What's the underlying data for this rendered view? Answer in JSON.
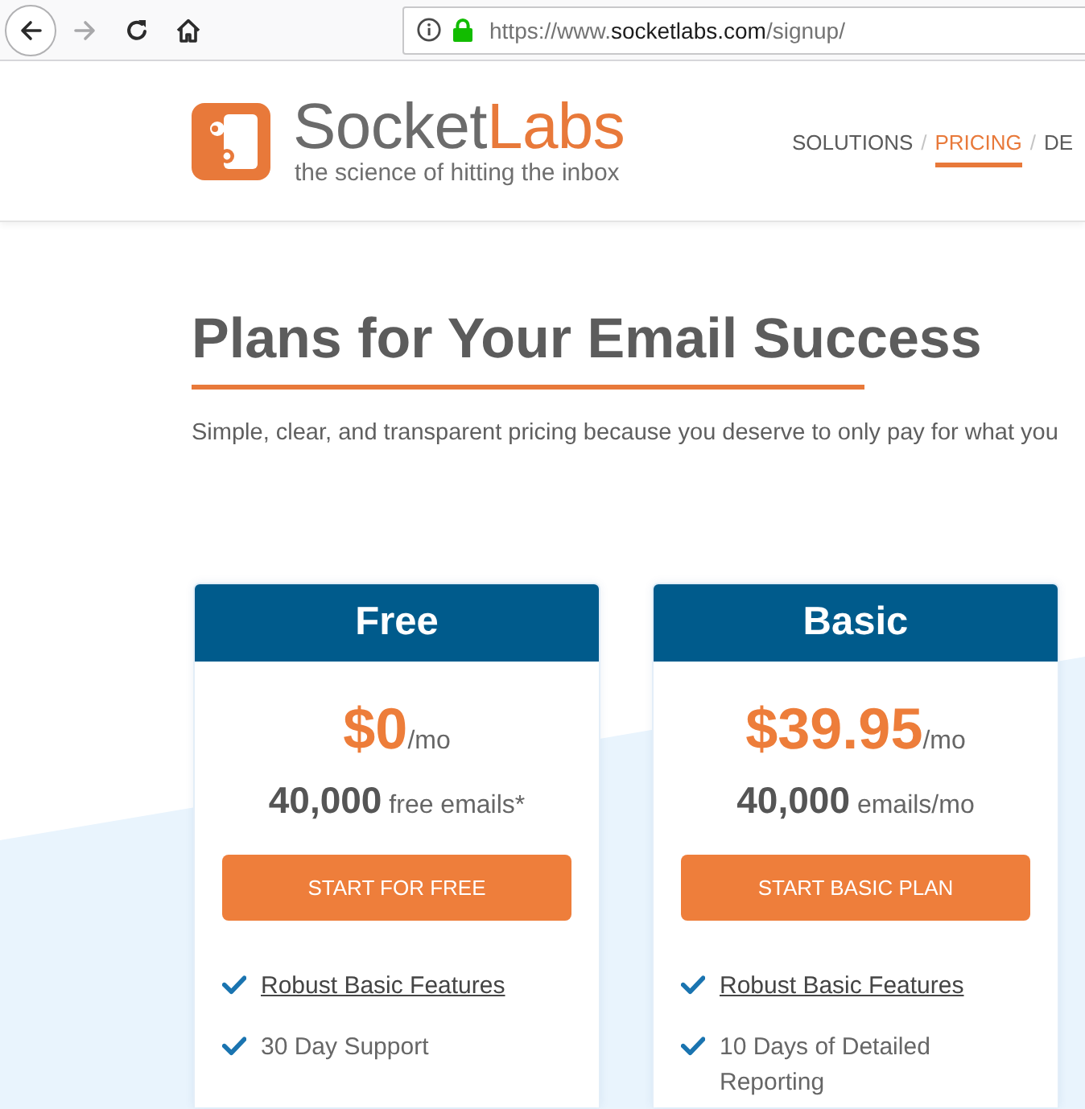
{
  "browser": {
    "nav_buttons": [
      {
        "kind": "back",
        "disabled": false
      },
      {
        "kind": "forward",
        "disabled": true
      },
      {
        "kind": "reload",
        "disabled": false
      },
      {
        "kind": "home",
        "disabled": false
      }
    ],
    "url_parts": [
      {
        "text": "https://www.",
        "emphasis": false
      },
      {
        "text": "socketlabs.com",
        "emphasis": true
      },
      {
        "text": "/signup/",
        "emphasis": false
      }
    ]
  },
  "header": {
    "brand": {
      "first": "Socket",
      "second": "Labs",
      "tagline": "the science of hitting the inbox"
    },
    "nav": {
      "items": [
        {
          "label": "SOLUTIONS",
          "selected": false
        },
        {
          "label": "PRICING",
          "selected": true
        },
        {
          "label": "DE",
          "selected": false
        }
      ],
      "separators": [
        "/",
        "/"
      ]
    }
  },
  "hero": {
    "title": "Plans for Your Email Success",
    "subtitle": "Simple, clear, and transparent pricing because you deserve to only pay for what you"
  },
  "plans": [
    {
      "name": "Free",
      "price": "$0",
      "period": "/mo",
      "allowance": "**40,000** free emails*",
      "button": "START FOR FREE",
      "features": [
        {
          "text": "Robust Basic Features",
          "link": true
        },
        {
          "text": "30 Day Support",
          "link": false
        }
      ]
    },
    {
      "name": "Basic",
      "price": "$39.95",
      "period": "/mo",
      "allowance": "**40,000** emails/mo",
      "button": "START BASIC PLAN",
      "features": [
        {
          "text": "Robust Basic Features",
          "link": true
        },
        {
          "text": "10 Days of Detailed Reporting",
          "link": false
        }
      ]
    }
  ]
}
